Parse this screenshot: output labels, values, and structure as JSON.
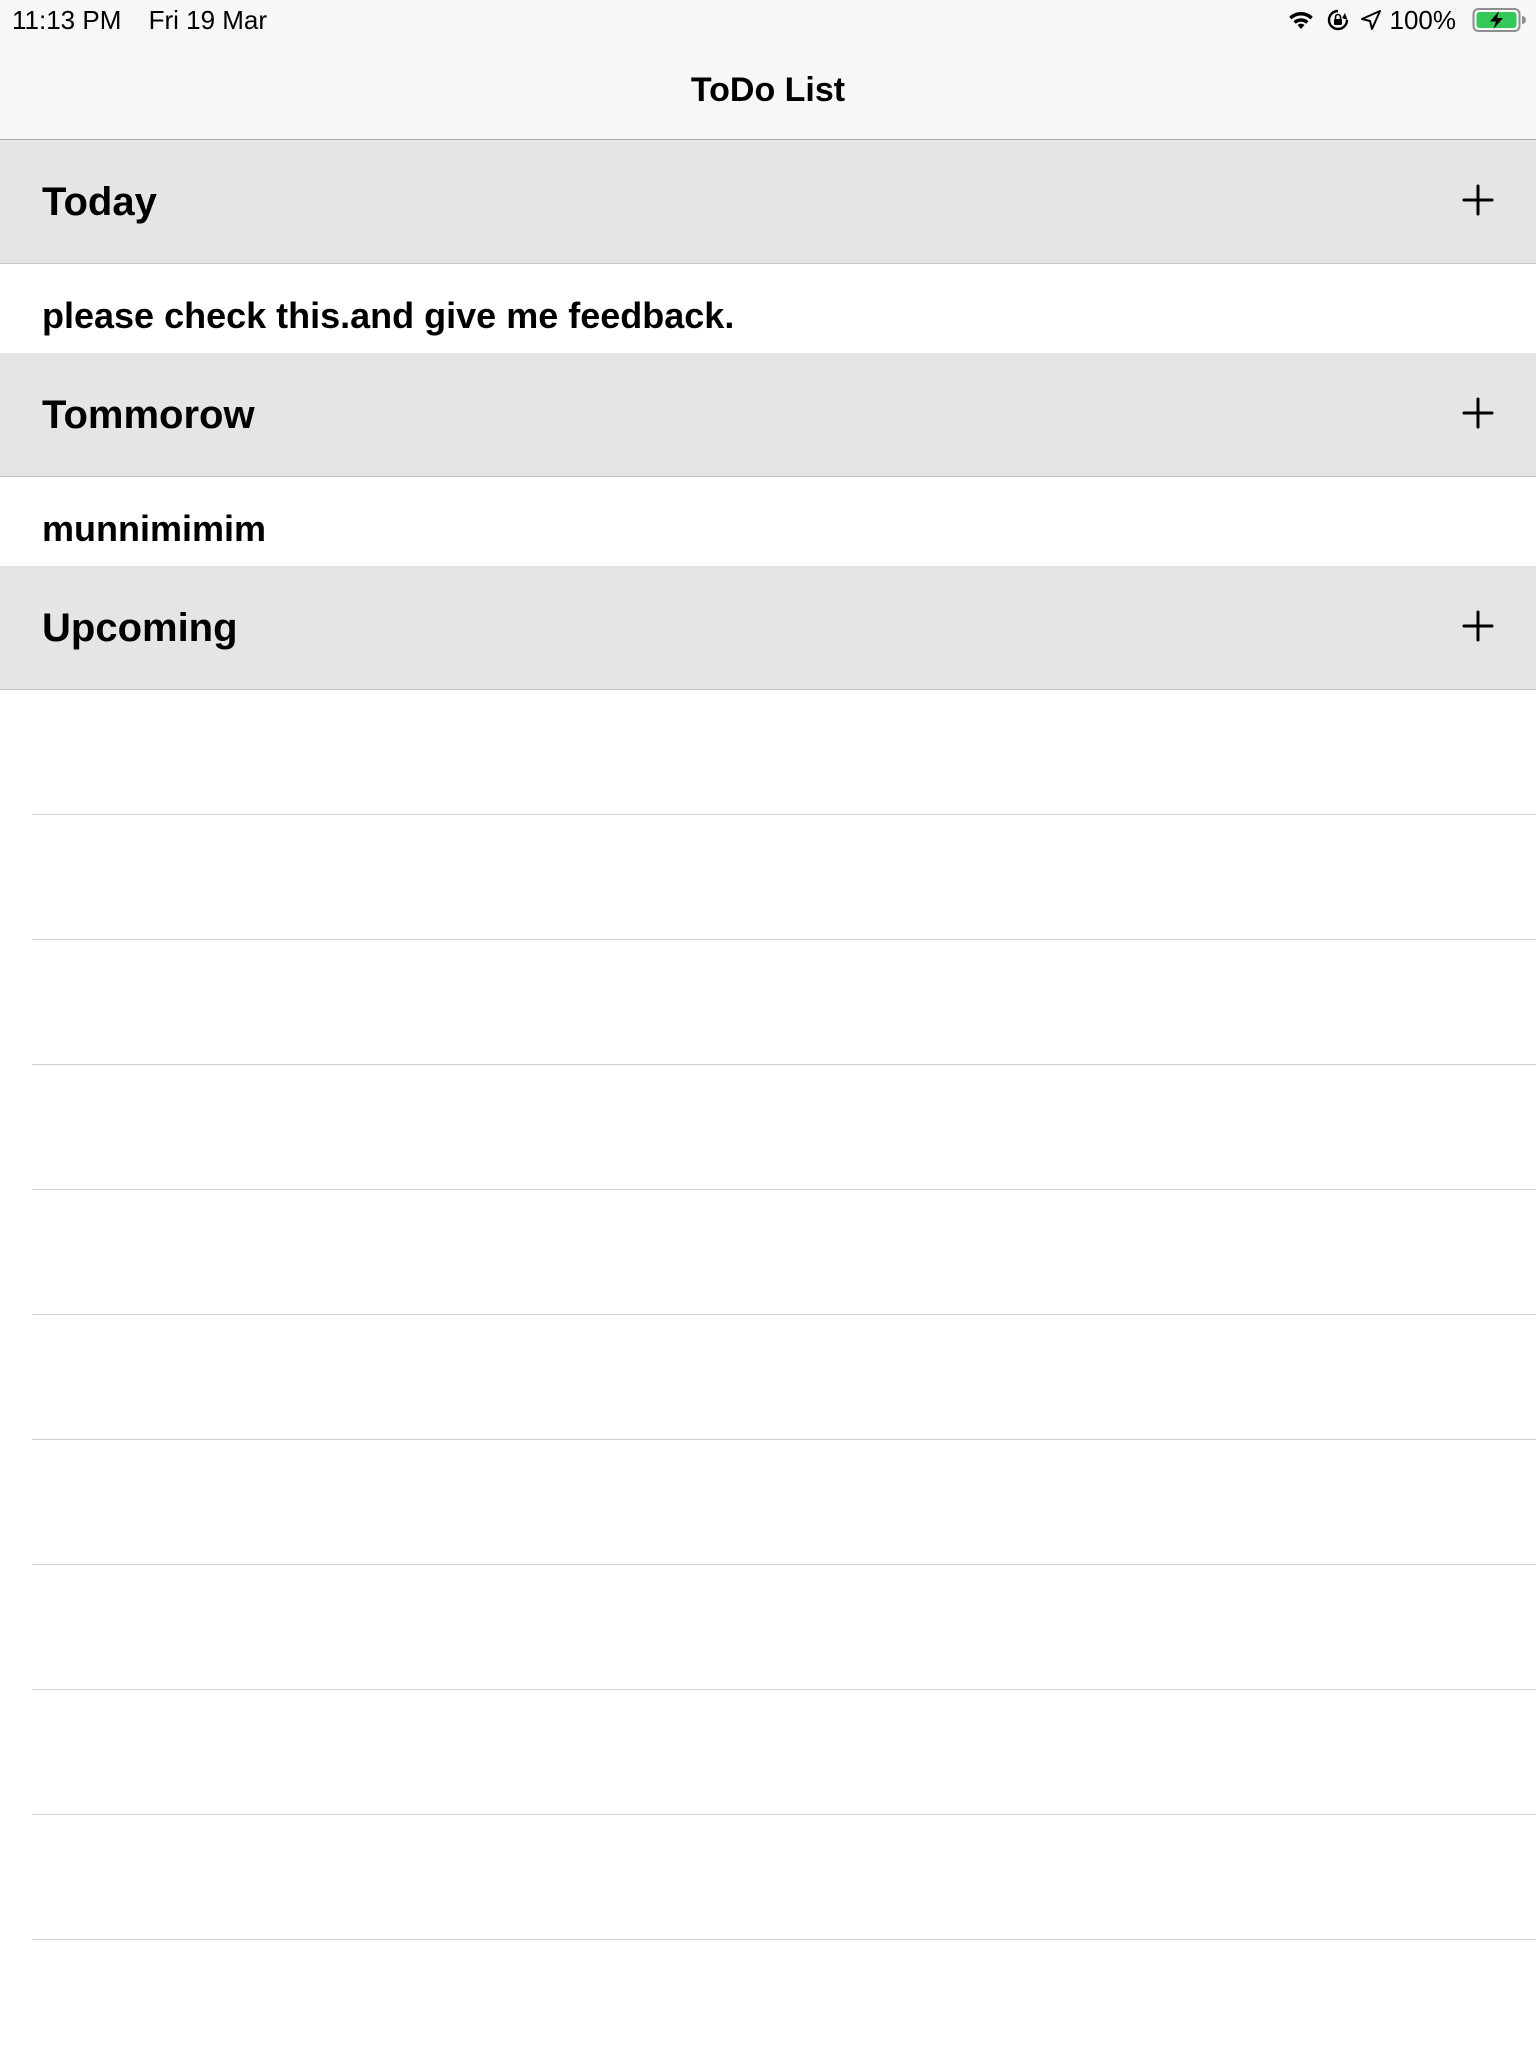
{
  "status_bar": {
    "time": "11:13 PM",
    "date": "Fri 19 Mar",
    "battery_percent": "100%",
    "icons": [
      "wifi-icon",
      "orientation-lock-icon",
      "location-icon",
      "battery-charging-icon"
    ],
    "battery_color": "#34c759"
  },
  "nav": {
    "title": "ToDo List"
  },
  "sections": [
    {
      "title": "Today",
      "add_icon": "plus-icon",
      "items": [
        "please check this.and give me feedback."
      ]
    },
    {
      "title": "Tommorow",
      "add_icon": "plus-icon",
      "items": [
        "munnimimim"
      ]
    },
    {
      "title": "Upcoming",
      "add_icon": "plus-icon",
      "items": []
    }
  ],
  "colors": {
    "section_header_bg": "#e5e5e5",
    "separator": "#d1d1d6",
    "nav_bg": "#f7f7f7"
  }
}
